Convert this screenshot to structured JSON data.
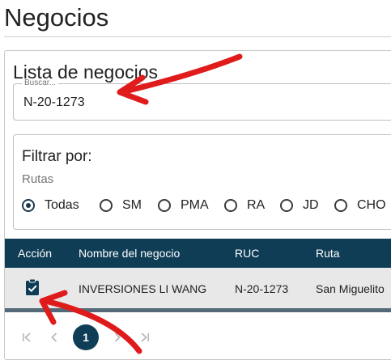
{
  "page": {
    "title": "Negocios"
  },
  "card": {
    "title": "Lista de negocios",
    "search": {
      "label": "Buscar...",
      "value": "N-20-1273"
    },
    "filter": {
      "title": "Filtrar por:",
      "group_label": "Rutas",
      "options": [
        "Todas",
        "SM",
        "PMA",
        "RA",
        "JD",
        "CHO"
      ],
      "selected": "Todas"
    },
    "table": {
      "columns": [
        "Acción",
        "Nombre del negocio",
        "RUC",
        "Ruta"
      ],
      "rows": [
        {
          "action_icon": "clipboard-check-icon",
          "name": "INVERSIONES LI WANG",
          "ruc": "N-20-1273",
          "route": "San Miguelito"
        }
      ]
    },
    "pagination": {
      "current_page": "1",
      "icons": [
        "first-page-icon",
        "prev-page-icon",
        "next-page-icon",
        "last-page-icon"
      ]
    }
  },
  "colors": {
    "header_bg": "#0f3d56",
    "row_bg": "#e8e8e8",
    "annotation_arrow": "#e01b1b"
  }
}
